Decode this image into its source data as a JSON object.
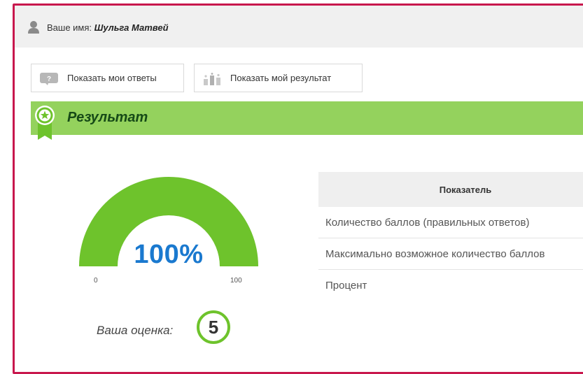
{
  "user": {
    "label": "Ваше имя:",
    "name": "Шульга Матвей"
  },
  "buttons": {
    "answers_label": "Показать мои ответы",
    "result_label": "Показать мой результат"
  },
  "result": {
    "title": "Результат"
  },
  "gauge": {
    "value_text": "100%",
    "percent": 100,
    "min_label": "0",
    "max_label": "100"
  },
  "grade": {
    "label": "Ваша оценка:",
    "value": "5"
  },
  "table": {
    "header": "Показатель",
    "rows": [
      {
        "label": "Количество баллов (правильных ответов)"
      },
      {
        "label": "Максимально возможное количество баллов"
      },
      {
        "label": "Процент"
      }
    ]
  },
  "colors": {
    "accent_green": "#94d25d",
    "gauge_green": "#6ec32c",
    "title_green": "#164a17",
    "percent_blue": "#1a79cf",
    "frame_border": "#c8174d"
  },
  "icons": {
    "user": "user-icon",
    "answers": "question-icon",
    "result": "bar-chart-icon",
    "badge": "award-ribbon-icon"
  }
}
